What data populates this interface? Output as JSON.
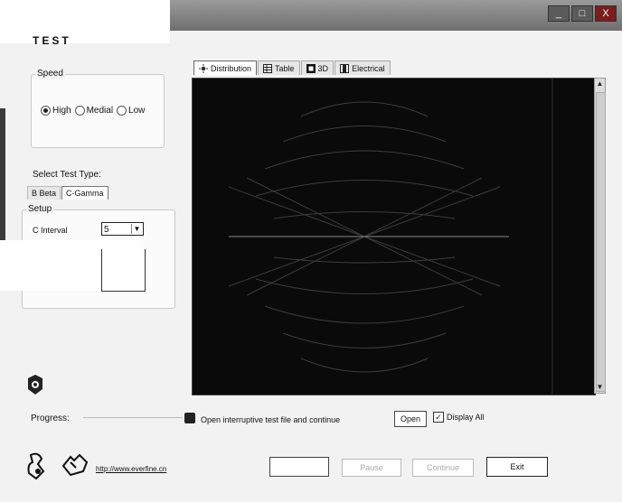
{
  "window": {
    "title": "TEST",
    "controls": [
      "_",
      "□",
      "X"
    ]
  },
  "speed": {
    "label": "Speed",
    "options": [
      "High",
      "Medial",
      "Low"
    ],
    "selected": "High"
  },
  "test_type": {
    "label": "Select Test Type:",
    "tabs": [
      "B Beta",
      "C-Gamma"
    ],
    "active_tab": "C-Gamma",
    "setup": {
      "label": "Setup",
      "c_interval_label": "C Interval",
      "c_interval_value": "5"
    }
  },
  "chart_tabs": [
    "Distribution",
    "Table",
    "3D",
    "Electrical"
  ],
  "progress": {
    "label": "Progress:"
  },
  "open_text": "Open interruptive test file and continue",
  "buttons": {
    "open": "Open",
    "display_all": "Display All",
    "pause": "Pause",
    "continue": "Continue",
    "exit": "Exit"
  },
  "display_all_checked": true,
  "footer": {
    "link": "http://www.everfine.cn"
  },
  "icons": {
    "chart_tab_icons": [
      "sun-icon",
      "table-icon",
      "cube-icon",
      "electrical-icon"
    ],
    "side_icon": "gear-icon",
    "footer_icons": [
      "plug-icon",
      "hand-icon"
    ]
  }
}
